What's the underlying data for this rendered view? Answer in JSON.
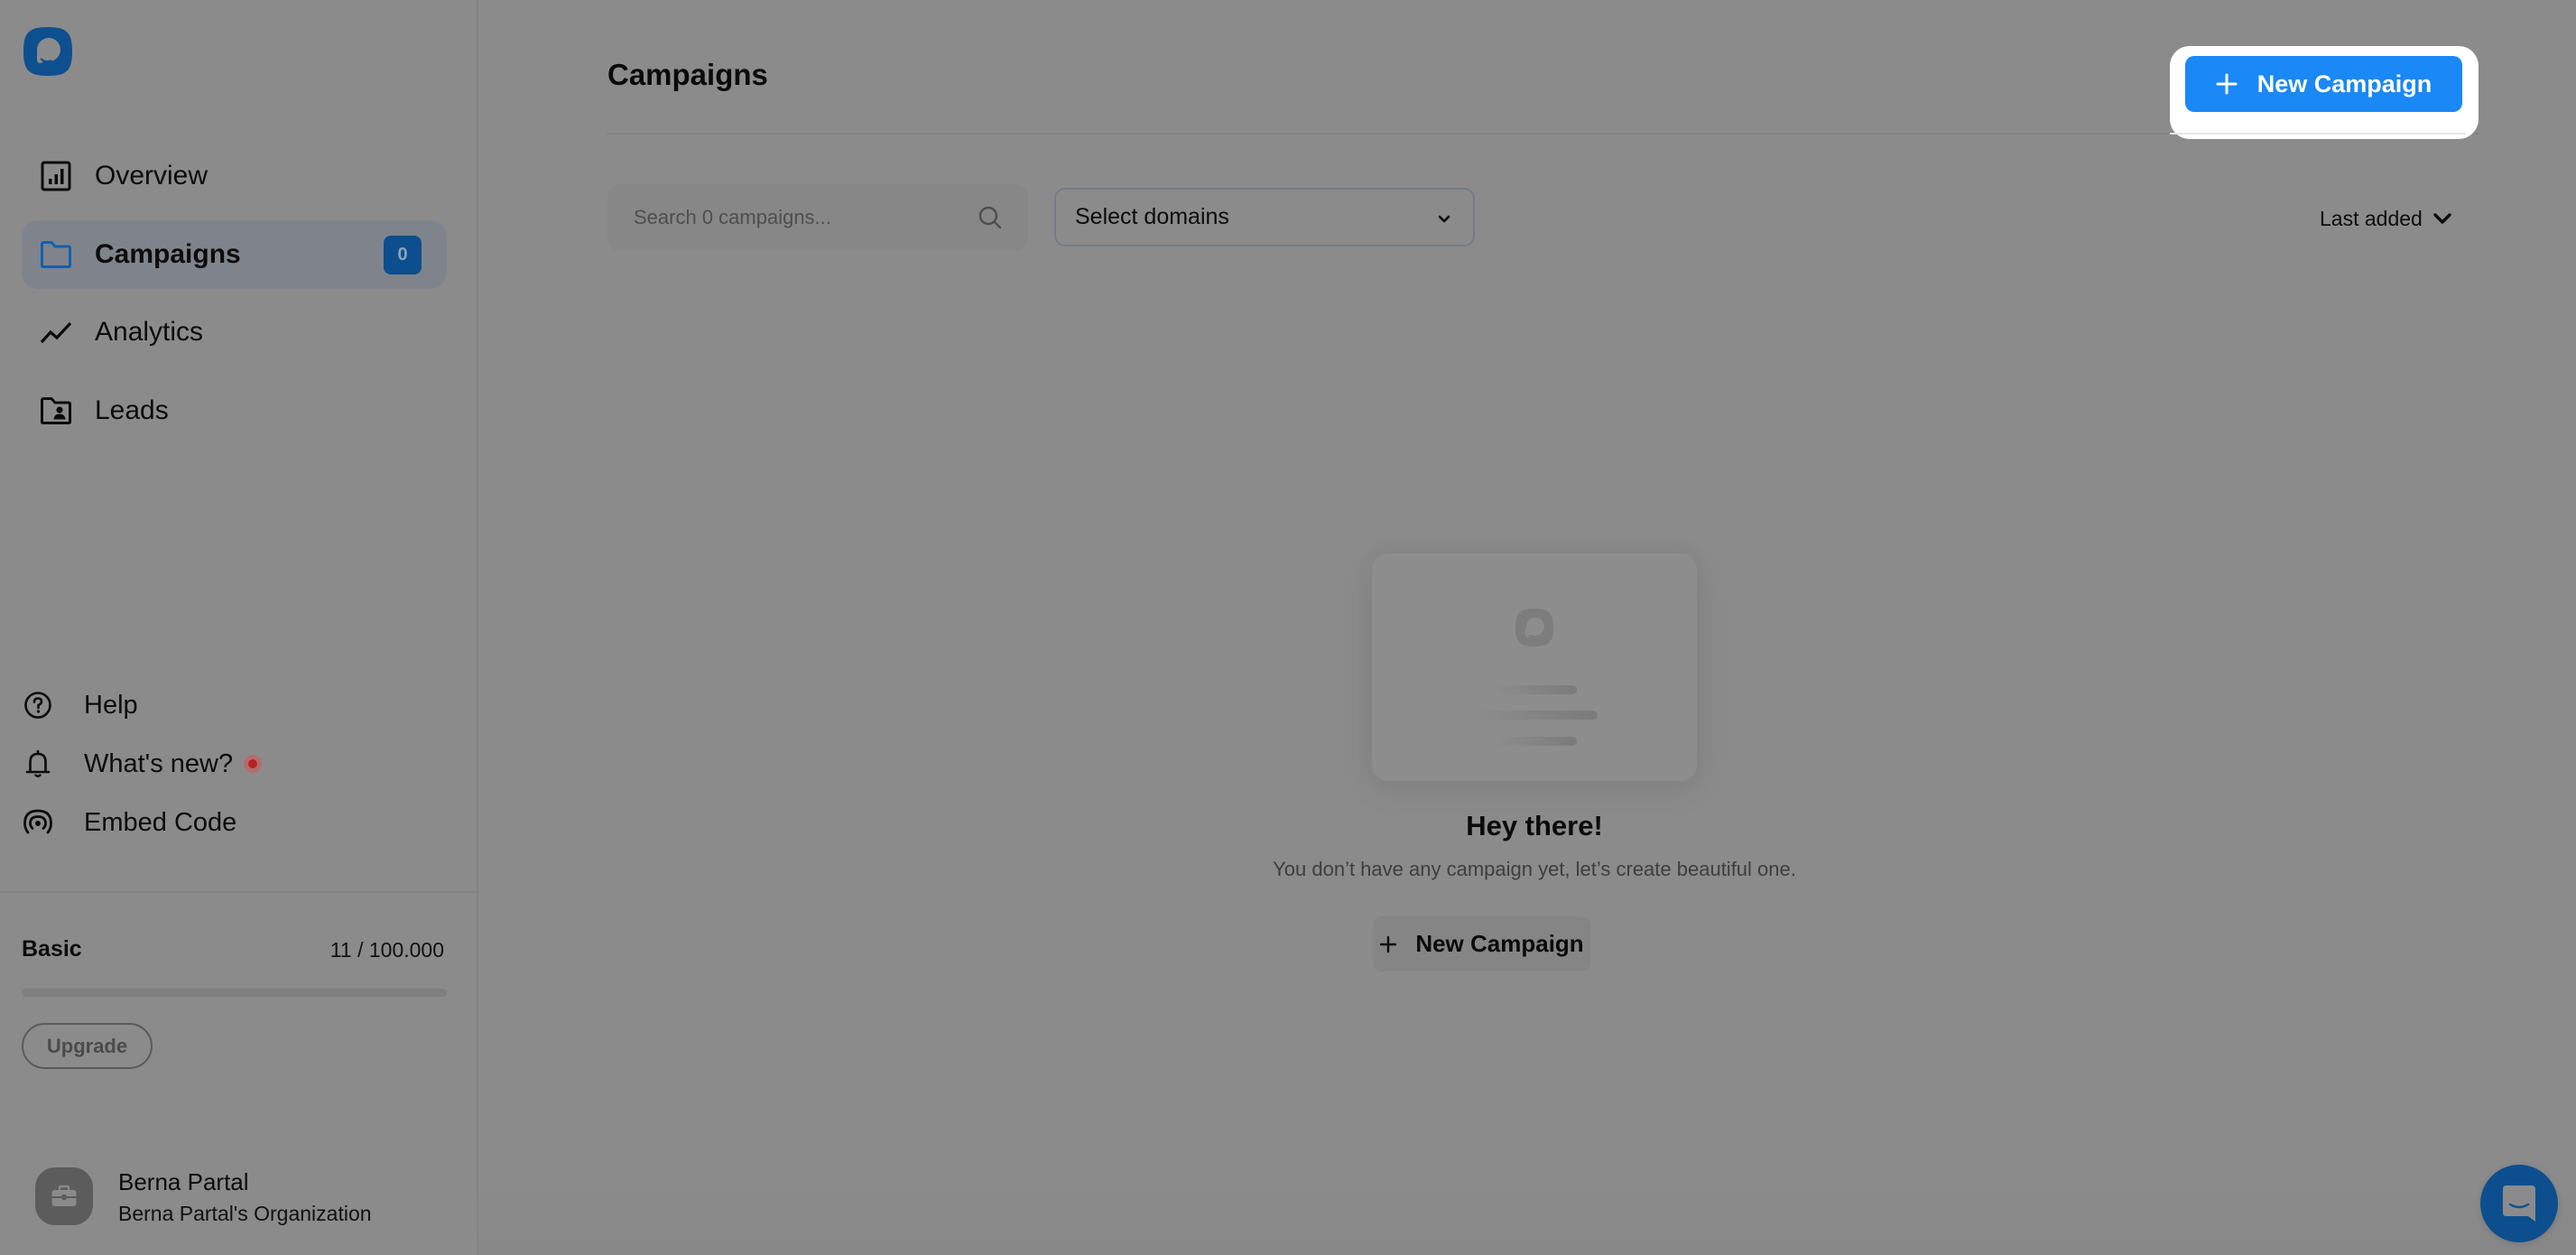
{
  "brand": {
    "logo_icon": "speech-bubble-logo",
    "accent_color": "#1a88f5",
    "dimmed_accent_color": "#0d4f8e"
  },
  "sidebar": {
    "nav": [
      {
        "label": "Overview",
        "icon": "bar-chart-square-icon",
        "active": false
      },
      {
        "label": "Campaigns",
        "icon": "folder-icon",
        "active": true,
        "badge": "0"
      },
      {
        "label": "Analytics",
        "icon": "trend-line-icon",
        "active": false
      },
      {
        "label": "Leads",
        "icon": "folder-user-icon",
        "active": false
      }
    ],
    "utilities": [
      {
        "label": "Help",
        "icon": "question-circle-icon"
      },
      {
        "label": "What's new?",
        "icon": "bell-icon",
        "has_notification": true
      },
      {
        "label": "Embed Code",
        "icon": "broadcast-icon"
      }
    ],
    "plan": {
      "name": "Basic",
      "usage_text": "11 / 100.000",
      "usage_used": 11,
      "usage_limit": 100000,
      "upgrade_label": "Upgrade"
    },
    "user": {
      "name": "Berna Partal",
      "organization": "Berna Partal's Organization",
      "avatar_icon": "briefcase-icon"
    }
  },
  "main": {
    "title": "Campaigns",
    "new_campaign_label": "New Campaign",
    "search": {
      "placeholder": "Search 0 campaigns...",
      "value": ""
    },
    "domain_filter": {
      "selected": "Select domains"
    },
    "sort": {
      "selected": "Last added"
    },
    "empty_state": {
      "title": "Hey there!",
      "subtitle": "You don’t have any campaign yet, let’s create beautiful one.",
      "button_label": "New Campaign"
    }
  },
  "overlay": {
    "highlighted_element": "New Campaign"
  },
  "support_chat": {
    "icon": "chat-smile-icon"
  }
}
